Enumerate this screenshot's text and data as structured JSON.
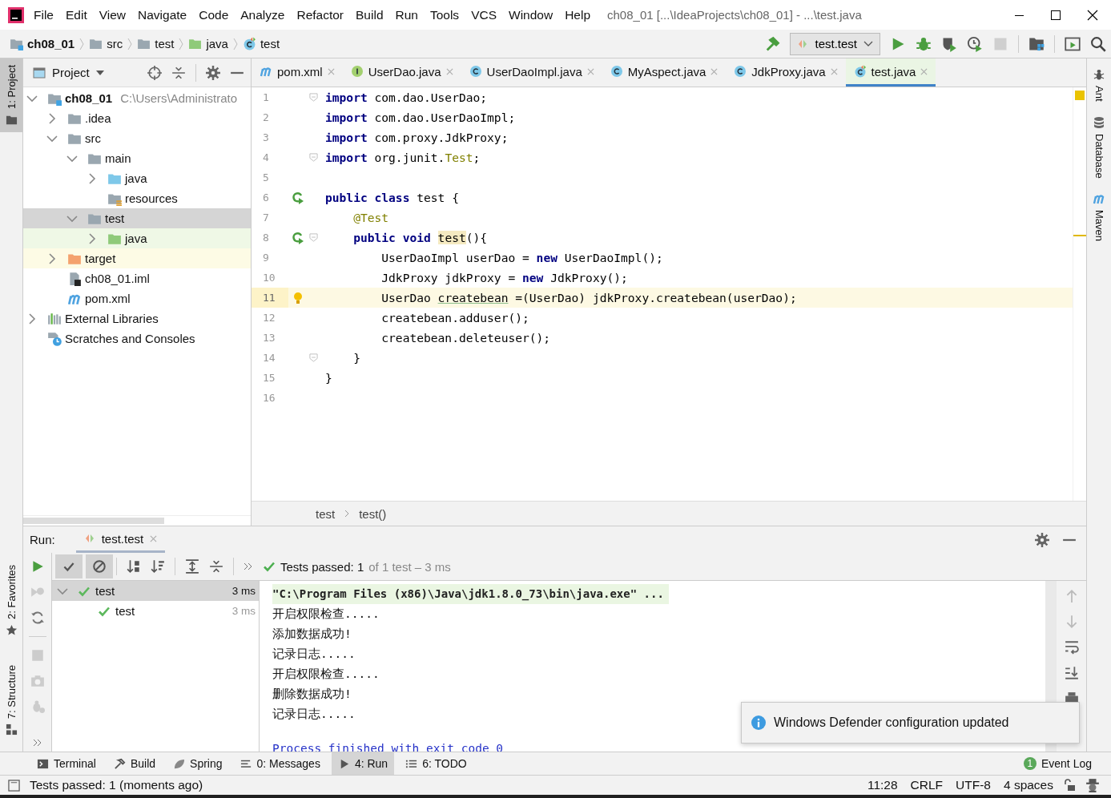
{
  "window": {
    "title": "ch08_01 [...\\IdeaProjects\\ch08_01] - ...\\test.java"
  },
  "menu": [
    "File",
    "Edit",
    "View",
    "Navigate",
    "Code",
    "Analyze",
    "Refactor",
    "Build",
    "Run",
    "Tools",
    "VCS",
    "Window",
    "Help"
  ],
  "breadcrumbs": [
    {
      "label": "ch08_01",
      "kind": "module"
    },
    {
      "label": "src",
      "kind": "folder"
    },
    {
      "label": "test",
      "kind": "folder"
    },
    {
      "label": "java",
      "kind": "test-folder"
    },
    {
      "label": "test",
      "kind": "test-class"
    }
  ],
  "run_config": "test.test",
  "project_panel": {
    "title": "Project"
  },
  "project_tree": [
    {
      "label": "ch08_01",
      "kind": "module",
      "location": "C:\\Users\\Administrato",
      "expanded": true,
      "selected": false,
      "children": [
        {
          "label": ".idea",
          "kind": "folder",
          "expanded": false,
          "selected": false
        },
        {
          "label": "src",
          "kind": "folder",
          "expanded": true,
          "selected": false,
          "children": [
            {
              "label": "main",
              "kind": "folder",
              "expanded": true,
              "selected": false,
              "children": [
                {
                  "label": "java",
                  "kind": "source-folder",
                  "expanded": false,
                  "selected": false
                },
                {
                  "label": "resources",
                  "kind": "resources-folder",
                  "selected": false
                }
              ]
            },
            {
              "label": "test",
              "kind": "folder",
              "expanded": true,
              "selected": true,
              "children": [
                {
                  "label": "java",
                  "kind": "test-folder",
                  "expanded": false,
                  "selected": false
                }
              ]
            }
          ]
        },
        {
          "label": "target",
          "kind": "excluded-folder",
          "expanded": false,
          "selected": false
        },
        {
          "label": "ch08_01.iml",
          "kind": "iml-file",
          "selected": false
        },
        {
          "label": "pom.xml",
          "kind": "maven",
          "selected": false
        }
      ]
    },
    {
      "label": "External Libraries",
      "kind": "libraries",
      "expanded": false,
      "selected": false
    },
    {
      "label": "Scratches and Consoles",
      "kind": "scratches",
      "selected": false
    }
  ],
  "editor_tabs": [
    {
      "label": "pom.xml",
      "kind": "maven",
      "selected": false
    },
    {
      "label": "UserDao.java",
      "kind": "interface",
      "selected": false
    },
    {
      "label": "UserDaoImpl.java",
      "kind": "class",
      "selected": false
    },
    {
      "label": "MyAspect.java",
      "kind": "class",
      "selected": false
    },
    {
      "label": "JdkProxy.java",
      "kind": "class",
      "selected": false
    },
    {
      "label": "test.java",
      "kind": "test-class",
      "selected": true
    }
  ],
  "code_lines": [
    {
      "number": "1",
      "current": false,
      "fold_mark": true,
      "tokens": [
        {
          "text": "import",
          "kind": "keyword"
        },
        {
          "text": " com.dao.UserDao;",
          "kind": "plain"
        }
      ]
    },
    {
      "number": "2",
      "current": false,
      "tokens": [
        {
          "text": "import",
          "kind": "keyword"
        },
        {
          "text": " com.dao.UserDaoImpl;",
          "kind": "plain"
        }
      ]
    },
    {
      "number": "3",
      "current": false,
      "tokens": [
        {
          "text": "import",
          "kind": "keyword"
        },
        {
          "text": " com.proxy.JdkProxy;",
          "kind": "plain"
        }
      ]
    },
    {
      "number": "4",
      "current": false,
      "fold_mark": true,
      "tokens": [
        {
          "text": "import",
          "kind": "keyword"
        },
        {
          "text": " org.junit.",
          "kind": "plain"
        },
        {
          "text": "Test",
          "kind": "annotation"
        },
        {
          "text": ";",
          "kind": "plain"
        }
      ]
    },
    {
      "number": "5",
      "current": false
    },
    {
      "number": "6",
      "current": false,
      "run_icon": true,
      "tokens": [
        {
          "text": "public class",
          "kind": "keyword"
        },
        {
          "text": " test {",
          "kind": "plain"
        }
      ]
    },
    {
      "number": "7",
      "current": false,
      "tokens": [
        {
          "text": "    @Test",
          "kind": "annotation"
        }
      ]
    },
    {
      "number": "8",
      "current": false,
      "run_icon": true,
      "fold_mark": true,
      "tokens": [
        {
          "text": "    public void ",
          "kind": "keyword"
        },
        {
          "text": "test",
          "kind": "highlight"
        },
        {
          "text": "(){",
          "kind": "plain"
        }
      ]
    },
    {
      "number": "9",
      "current": false,
      "tokens": [
        {
          "text": "        UserDaoImpl userDao = ",
          "kind": "plain"
        },
        {
          "text": "new",
          "kind": "keyword"
        },
        {
          "text": " UserDaoImpl();",
          "kind": "plain"
        }
      ]
    },
    {
      "number": "10",
      "current": false,
      "tokens": [
        {
          "text": "        JdkProxy jdkProxy = ",
          "kind": "plain"
        },
        {
          "text": "new",
          "kind": "keyword"
        },
        {
          "text": " JdkProxy();",
          "kind": "plain"
        }
      ]
    },
    {
      "number": "11",
      "current": true,
      "intention_bulb": true,
      "tokens": [
        {
          "text": "        UserDao ",
          "kind": "plain"
        },
        {
          "text": "createbean",
          "kind": "unused"
        },
        {
          "text": " =(UserDao) jdkProxy.createbean(userDao);",
          "kind": "plain"
        }
      ]
    },
    {
      "number": "12",
      "current": false,
      "tokens": [
        {
          "text": "        createbean.adduser();",
          "kind": "plain"
        }
      ]
    },
    {
      "number": "13",
      "current": false,
      "tokens": [
        {
          "text": "        createbean.deleteuser();",
          "kind": "plain"
        }
      ]
    },
    {
      "number": "14",
      "current": false,
      "fold_mark": true,
      "tokens": [
        {
          "text": "    }",
          "kind": "plain"
        }
      ]
    },
    {
      "number": "15",
      "current": false,
      "tokens": [
        {
          "text": "}",
          "kind": "plain"
        }
      ]
    },
    {
      "number": "16",
      "current": false
    }
  ],
  "editor_breadcrumbs": [
    "test",
    "test()"
  ],
  "run_panel": {
    "label": "Run:",
    "tab": "test.test",
    "summary": "Tests passed: 1",
    "summary_detail": "of 1 test – 3 ms",
    "toggles": [
      {
        "kind": "passed",
        "on": true
      },
      {
        "kind": "ignored",
        "on": true
      }
    ],
    "tests": [
      {
        "name": "test",
        "time": "3 ms",
        "selected": true,
        "expanded": true,
        "children": [
          {
            "name": "test",
            "time": "3 ms",
            "selected": false
          }
        ]
      }
    ],
    "console": [
      {
        "text": "\"C:\\Program Files (x86)\\Java\\jdk1.8.0_73\\bin\\java.exe\" ...",
        "kind": "command"
      },
      {
        "text": "开启权限检查.....",
        "kind": "output"
      },
      {
        "text": "添加数据成功!",
        "kind": "output"
      },
      {
        "text": "记录日志.....",
        "kind": "output"
      },
      {
        "text": "开启权限检查.....",
        "kind": "output"
      },
      {
        "text": "删除数据成功!",
        "kind": "output"
      },
      {
        "text": "记录日志.....",
        "kind": "output"
      },
      {
        "text": "Process finished with exit code 0",
        "kind": "exit"
      }
    ]
  },
  "notification": "Windows Defender configuration updated",
  "tool_strip": [
    {
      "label": "Terminal",
      "kind": "terminal",
      "selected": false
    },
    {
      "label": "Build",
      "kind": "build",
      "selected": false
    },
    {
      "label": "Spring",
      "kind": "spring",
      "selected": false
    },
    {
      "label": "0: Messages",
      "kind": "messages",
      "selected": false
    },
    {
      "label": "4: Run",
      "kind": "run",
      "selected": true
    },
    {
      "label": "6: TODO",
      "kind": "todo",
      "selected": false
    }
  ],
  "event_log": {
    "label": "Event Log",
    "count": "1"
  },
  "side_tabs": {
    "left_top": [
      {
        "label": "1: Project",
        "selected": true
      }
    ],
    "left_bottom": [
      {
        "label": "2: Favorites",
        "kind": "favorites"
      },
      {
        "label": "7: Structure",
        "kind": "structure"
      }
    ],
    "right": [
      {
        "label": "Ant",
        "kind": "ant"
      },
      {
        "label": "Database",
        "kind": "database"
      },
      {
        "label": "Maven",
        "kind": "maven"
      }
    ]
  },
  "status_bar": {
    "message": "Tests passed: 1 (moments ago)",
    "position": "11:28",
    "line_separator": "CRLF",
    "encoding": "UTF-8",
    "indent": "4 spaces"
  }
}
